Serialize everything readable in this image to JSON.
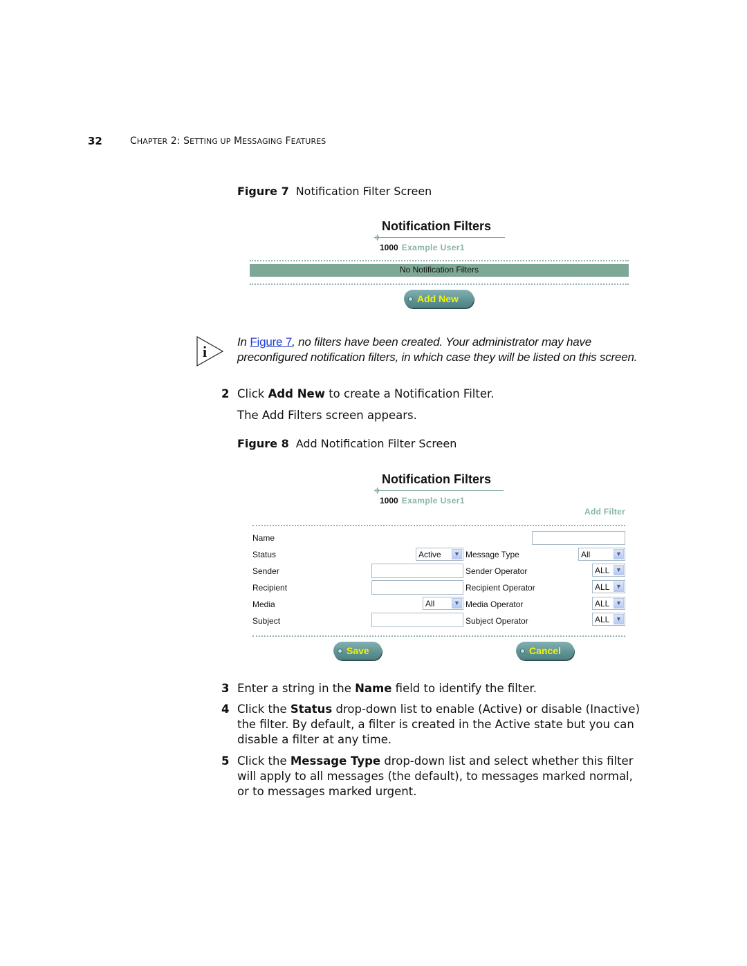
{
  "header": {
    "page_number": "32",
    "chapter_prefix": "C",
    "chapter_text_parts": [
      "HAPTER",
      " 2: S",
      "ETTING UP",
      " M",
      "ESSAGING",
      " F",
      "EATURES"
    ],
    "chapter_full": "Chapter 2: Setting up Messaging Features"
  },
  "figure7": {
    "label": "Figure 7",
    "caption": "Notification Filter Screen",
    "ui": {
      "title": "Notification Filters",
      "user_number": "1000",
      "user_name": "Example User1",
      "status_bar_text": "No Notification Filters",
      "add_new_label": "Add New"
    }
  },
  "note": {
    "icon": "info-icon",
    "prefix": "In ",
    "link_text": "Figure 7",
    "text": ", no filters have been created. Your administrator may have preconfigured notification filters, in which case they will be listed on this screen."
  },
  "step2": {
    "number": "2",
    "pre": "Click ",
    "bold": "Add New",
    "post": " to create a Notification Filter.",
    "followup": "The Add Filters screen appears."
  },
  "figure8": {
    "label": "Figure 8",
    "caption": "Add Notification Filter Screen",
    "ui": {
      "title": "Notification Filters",
      "user_number": "1000",
      "user_name": "Example User1",
      "section_link": "Add Filter",
      "fields": {
        "name_label": "Name",
        "name_value": "",
        "status_label": "Status",
        "status_value": "Active",
        "message_type_label": "Message Type",
        "message_type_value": "All",
        "sender_label": "Sender",
        "sender_value": "",
        "sender_operator_label": "Sender Operator",
        "sender_operator_value": "ALL",
        "recipient_label": "Recipient",
        "recipient_value": "",
        "recipient_operator_label": "Recipient Operator",
        "recipient_operator_value": "ALL",
        "media_label": "Media",
        "media_value": "All",
        "media_operator_label": "Media Operator",
        "media_operator_value": "ALL",
        "subject_label": "Subject",
        "subject_value": "",
        "subject_operator_label": "Subject Operator",
        "subject_operator_value": "ALL"
      },
      "save_label": "Save",
      "cancel_label": "Cancel"
    }
  },
  "steps": [
    {
      "number": "3",
      "pre": "Enter a string in the ",
      "bold": "Name",
      "post": " field to identify the filter."
    },
    {
      "number": "4",
      "pre": "Click the ",
      "bold": "Status",
      "post": " drop-down list to enable (Active) or disable (Inactive) the filter. By default, a filter is created in the Active state but you can disable a filter at any time."
    },
    {
      "number": "5",
      "pre": "Click the ",
      "bold": "Message Type",
      "post": " drop-down list and select whether this filter will apply to all messages (the default), to messages marked normal, or to messages marked urgent."
    }
  ],
  "colors": {
    "accent_green": "#7ea896",
    "user_name_green": "#86b4a6",
    "button_teal": "#5f9294",
    "button_text_yellow": "#f4f400",
    "link_blue": "#1f3fd6"
  }
}
